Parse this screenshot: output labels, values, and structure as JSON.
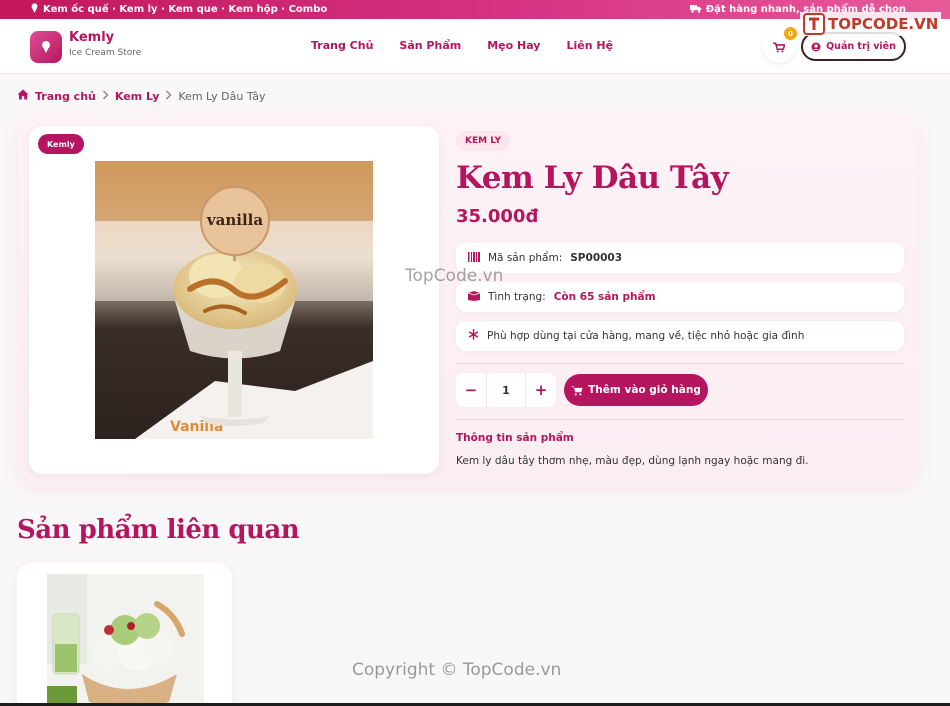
{
  "topbar": {
    "left_text": "Kem ốc quế · Kem ly · Kem que · Kem hộp · Combo",
    "right_text": "Đặt hàng nhanh, sản phẩm dễ chọn"
  },
  "header": {
    "brand_name": "Kemly",
    "brand_sub": "Ice Cream Store",
    "nav": [
      "Trang Chủ",
      "Sản Phẩm",
      "Mẹo Hay",
      "Liên Hệ"
    ],
    "cart_count": "0",
    "admin_label": "Quản trị viên",
    "watermark_logo": "TOPCODE.VN"
  },
  "breadcrumb": {
    "home": "Trang chủ",
    "category": "Kem Ly",
    "current": "Kem Ly Dâu Tây"
  },
  "product": {
    "image_badge": "Kemly",
    "category": "KEM LY",
    "title": "Kem Ly Dâu Tây",
    "price": "35.000đ",
    "sku_label": "Mã sản phẩm:",
    "sku_value": "SP00003",
    "stock_label": "Tình trạng:",
    "stock_value": "Còn 65 sản phẩm",
    "usage_text": "Phù hợp dùng tại cửa hàng, mang về, tiệc nhỏ hoặc gia đình",
    "quantity": "1",
    "add_to_cart": "Thêm vào giỏ hàng",
    "info_heading": "Thông tin sản phẩm",
    "info_desc": "Kem ly dâu tây thơm nhẹ, màu đẹp, dùng lạnh ngay hoặc mang đi.",
    "photo_text": "vanilla"
  },
  "related": {
    "title": "Sản phẩm liên quan"
  },
  "watermarks": {
    "center": "TopCode.vn",
    "bottom": "Copyright © TopCode.vn"
  },
  "colors": {
    "accent": "#b5155e",
    "topbar": "#d63384",
    "badge": "#f3a712"
  }
}
